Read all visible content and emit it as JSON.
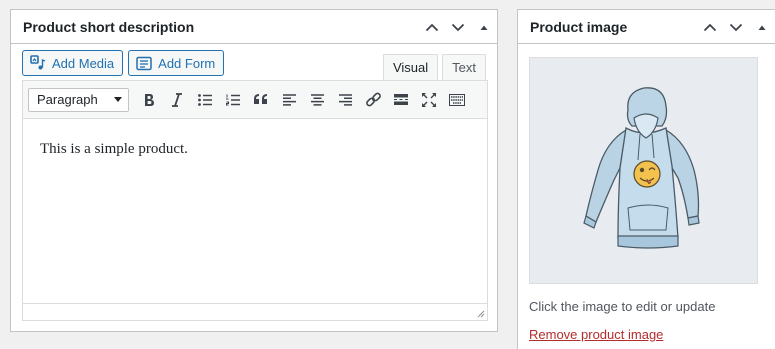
{
  "short_description": {
    "title": "Product short description",
    "add_media_label": "Add Media",
    "add_form_label": "Add Form",
    "tabs": [
      {
        "label": "Visual",
        "active": true
      },
      {
        "label": "Text",
        "active": false
      }
    ],
    "format_select": {
      "selected": "Paragraph"
    },
    "toolbar_icons": [
      "bold-icon",
      "italic-icon",
      "bullet-list-icon",
      "numbered-list-icon",
      "blockquote-icon",
      "align-left-icon",
      "align-center-icon",
      "align-right-icon",
      "link-icon",
      "read-more-icon",
      "fullscreen-icon",
      "toolbar-toggle-icon"
    ],
    "content": "This is a simple product."
  },
  "product_image": {
    "title": "Product image",
    "caption": "Click the image to edit or update",
    "remove_label": "Remove product image"
  },
  "colors": {
    "accent": "#2271b1",
    "danger": "#b32d2e",
    "border": "#c3c4c7",
    "background": "#f0f0f1"
  }
}
